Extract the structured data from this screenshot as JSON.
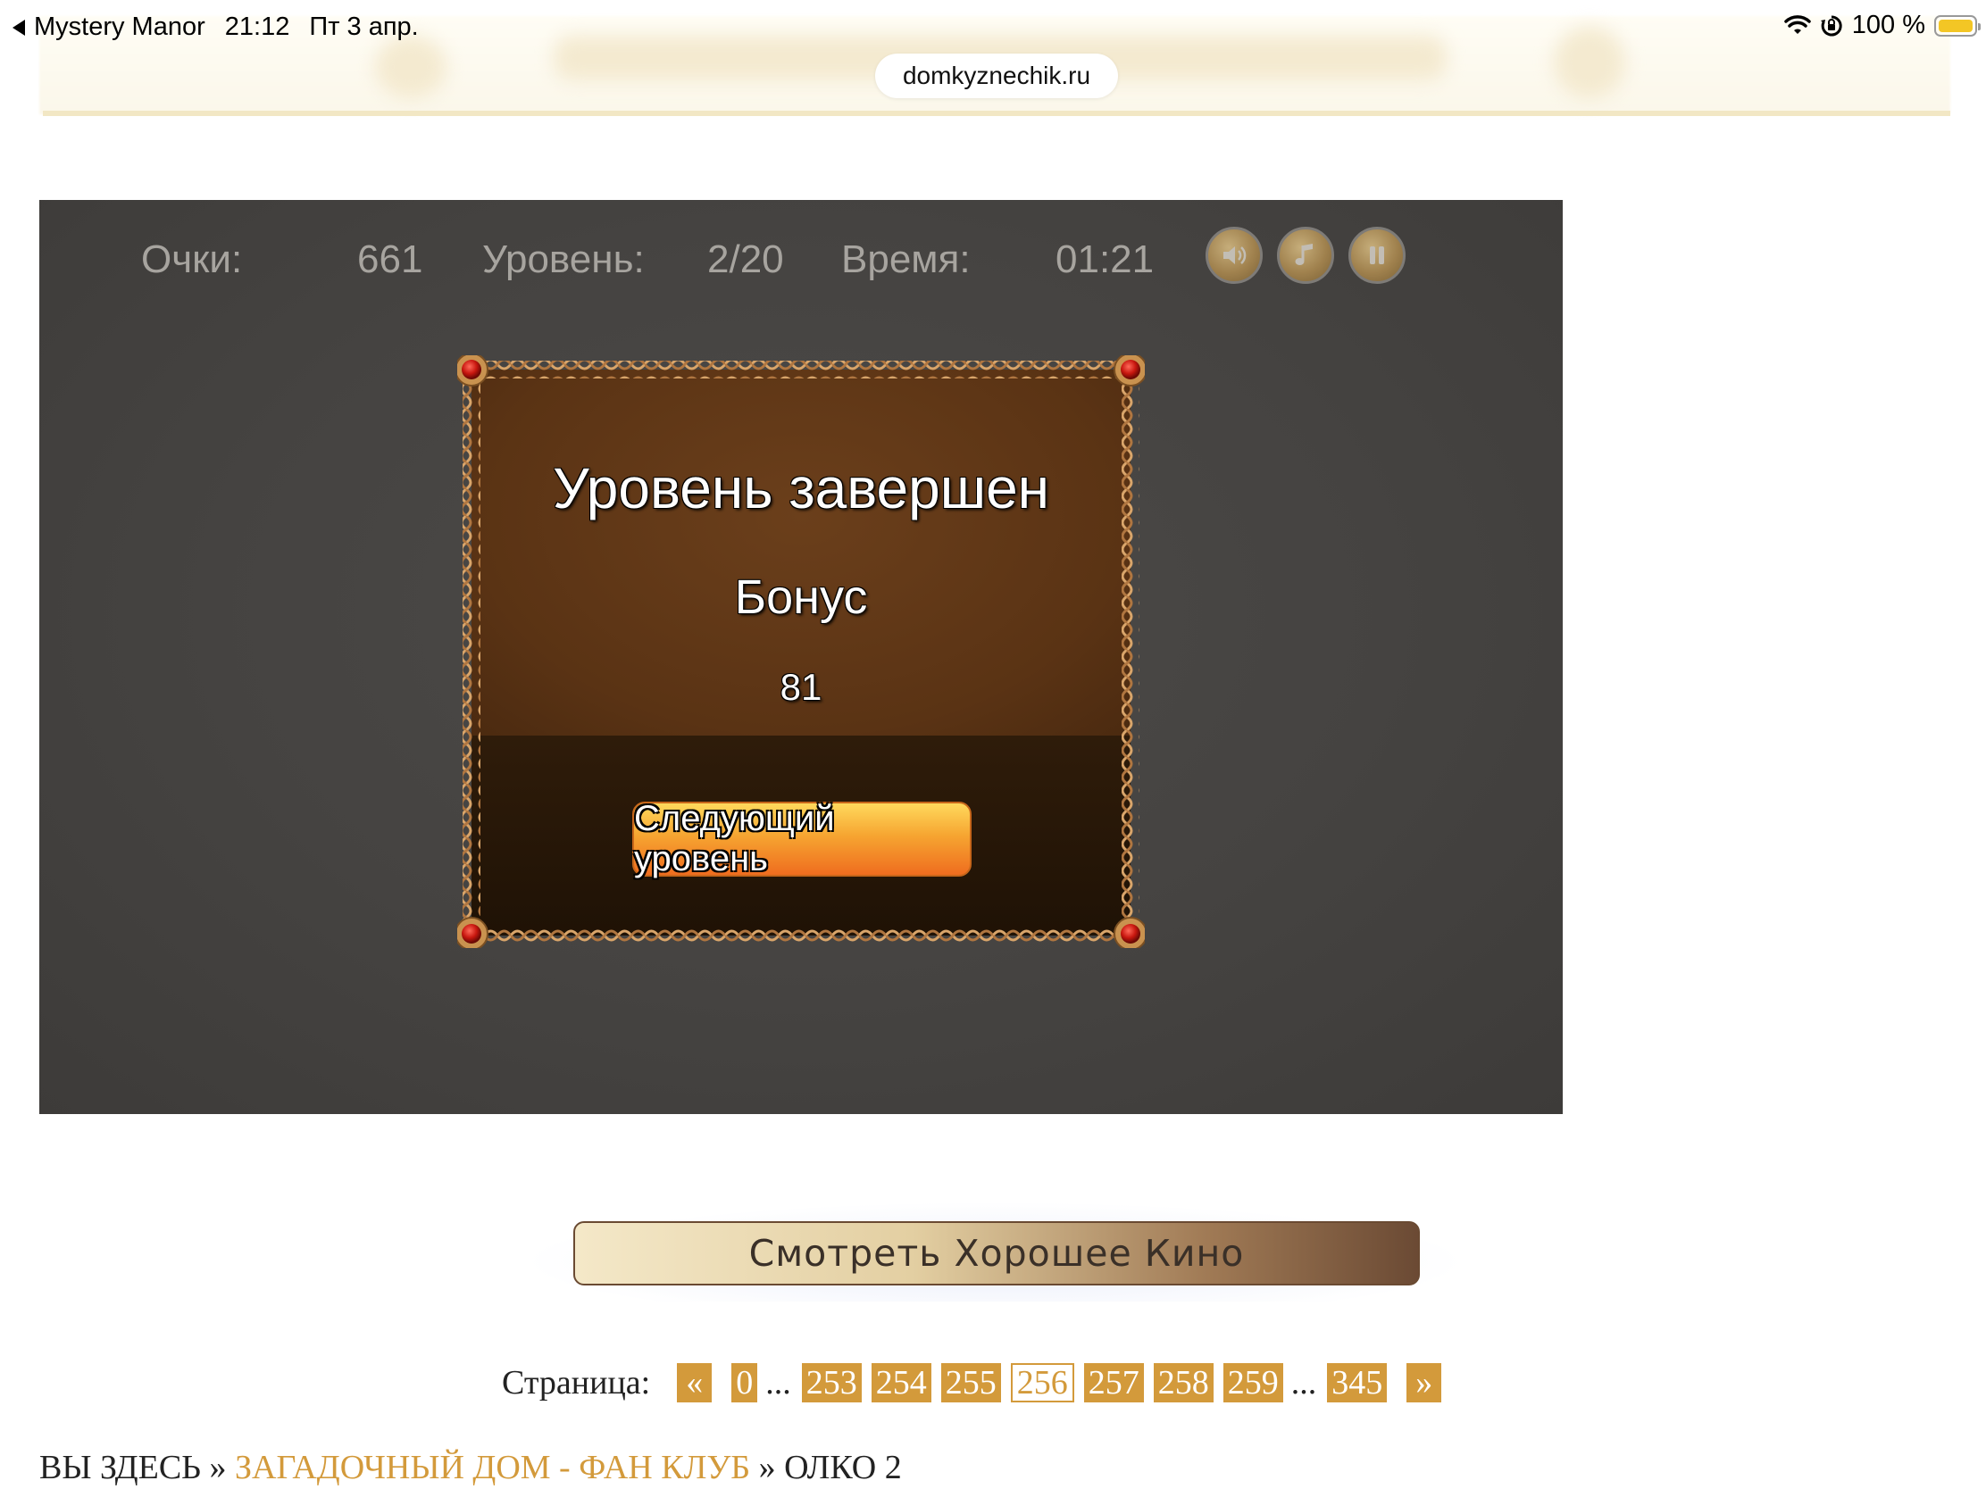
{
  "status_bar": {
    "back_app": "Mystery Manor",
    "time": "21:12",
    "date": "Пт 3 апр.",
    "battery": "100 %",
    "battery_level": 1.0
  },
  "browser": {
    "url": "domkyznechik.ru"
  },
  "game": {
    "hud": {
      "score_label": "Очки:",
      "score_value": "661",
      "level_label": "Уровень:",
      "level_value": "2/20",
      "time_label": "Время:",
      "time_value": "01:21"
    },
    "dialog": {
      "title": "Уровень завершен",
      "bonus_label": "Бонус",
      "bonus_value": "81",
      "next_button": "Следующий уровень"
    }
  },
  "watch_button": "Смотреть Хорошее Кино",
  "pagination": {
    "label": "Страница:",
    "prev": "«",
    "next": "»",
    "ellipsis": "...",
    "pages": [
      "0",
      "253",
      "254",
      "255",
      "256",
      "257",
      "258",
      "259",
      "345"
    ],
    "current": "256"
  },
  "breadcrumb": {
    "prefix": "ВЫ ЗДЕСЬ",
    "separator": "»",
    "items": [
      "ЗАГАДОЧНЫЙ ДОМ - ФАН КЛУБ",
      "ОЛКО 2"
    ]
  },
  "icons": {
    "back": "back-triangle-icon",
    "wifi": "wifi-icon",
    "orientation_lock": "orientation-lock-icon",
    "battery": "battery-icon",
    "sound": "speaker-icon",
    "music": "music-note-icon",
    "pause": "pause-icon"
  },
  "colors": {
    "accent": "#d39a3b",
    "game_bg": "#454341",
    "battery": "#f3c625"
  }
}
